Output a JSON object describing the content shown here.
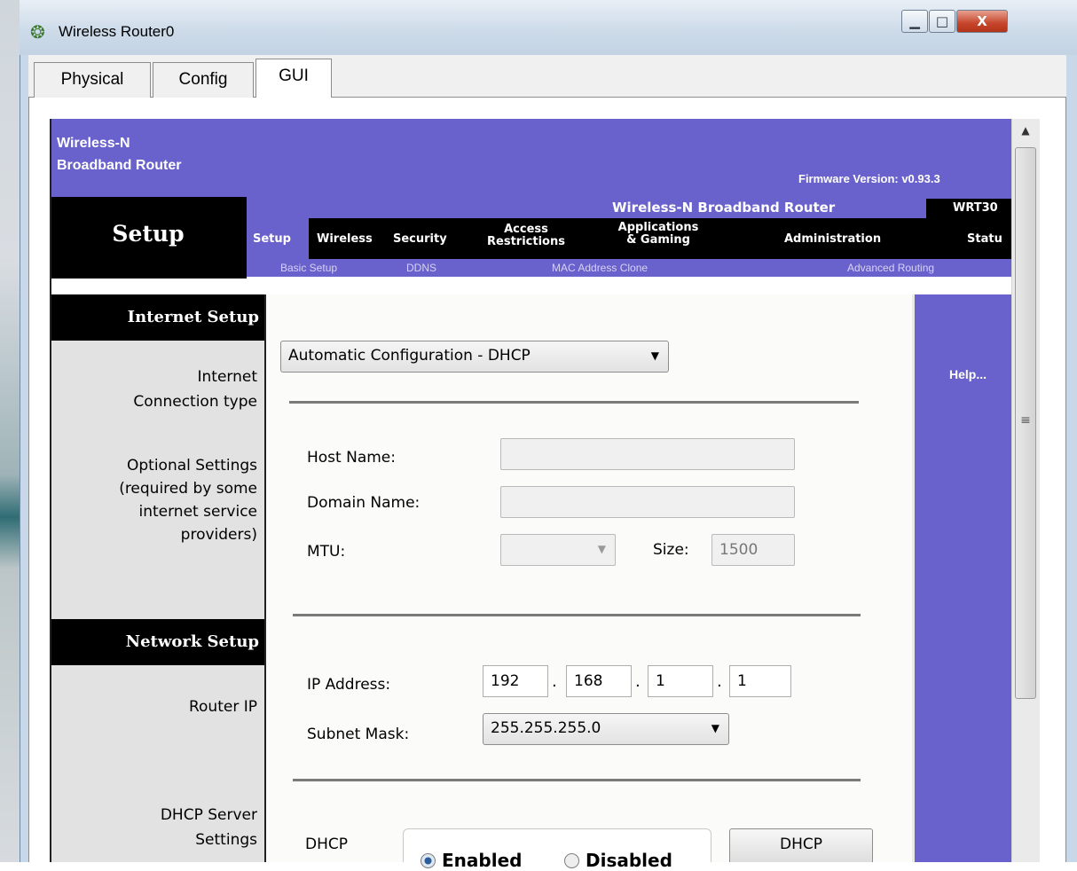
{
  "window": {
    "title": "Wireless Router0",
    "controls": {
      "minimize": "▁",
      "maximize": "□",
      "close": "X"
    }
  },
  "tabs": [
    "Physical",
    "Config",
    "GUI"
  ],
  "active_tab": "GUI",
  "router": {
    "brand_line1": "Wireless-N",
    "brand_line2": "Broadband Router",
    "firmware": "Firmware Version: v0.93.3",
    "product_name": "Wireless-N Broadband Router",
    "model": "WRT30",
    "section_title": "Setup",
    "nav": {
      "setup": "Setup",
      "wireless": "Wireless",
      "security": "Security",
      "access_line1": "Access",
      "access_line2": "Restrictions",
      "apps_line1": "Applications",
      "apps_line2": "& Gaming",
      "administration": "Administration",
      "status": "Statu"
    },
    "subnav": {
      "basic_setup": "Basic Setup",
      "ddns": "DDNS",
      "mac_clone": "MAC Address Clone",
      "advanced_routing": "Advanced Routing"
    }
  },
  "left": {
    "internet_setup": "Internet Setup",
    "internet_connection_type_line1": "Internet",
    "internet_connection_type_line2": "Connection type",
    "optional_line1": "Optional Settings",
    "optional_line2": "(required by some",
    "optional_line3": "internet service",
    "optional_line4": "providers)",
    "network_setup": "Network Setup",
    "router_ip": "Router IP",
    "dhcp_server_line1": "DHCP Server",
    "dhcp_server_line2": "Settings"
  },
  "form": {
    "connection_type": "Automatic Configuration - DHCP",
    "host_name_label": "Host Name:",
    "host_name_value": "",
    "domain_name_label": "Domain Name:",
    "domain_name_value": "",
    "mtu_label": "MTU:",
    "mtu_value": "",
    "size_label": "Size:",
    "size_value": "1500",
    "ip_label": "IP Address:",
    "ip_octets": [
      "192",
      "168",
      "1",
      "1"
    ],
    "subnet_label": "Subnet Mask:",
    "subnet_value": "255.255.255.0",
    "dhcp_label": "DHCP",
    "dhcp_enabled": "Enabled",
    "dhcp_disabled": "Disabled",
    "dhcp_selected": "Enabled",
    "dhcp_button": "DHCP"
  },
  "help": {
    "link": "Help..."
  },
  "icons": {
    "window_icon": "router-icon",
    "dropdown": "chevron-down-icon",
    "scroll_up": "arrow-up-icon",
    "scroll_grip": "grip-icon"
  },
  "colors": {
    "router_purple": "#6a62cc",
    "router_black": "#000000",
    "label_column": "#e2e2e2"
  }
}
